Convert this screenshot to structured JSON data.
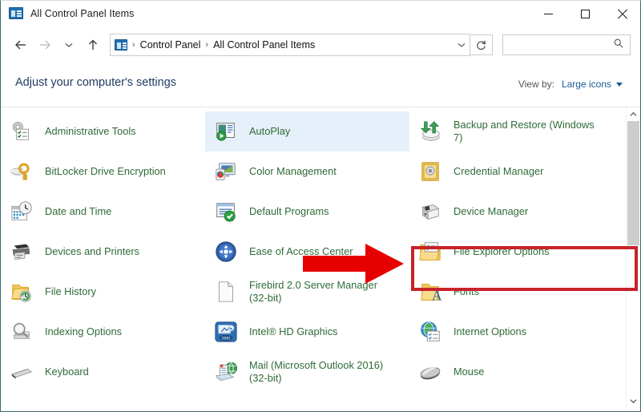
{
  "window": {
    "title": "All Control Panel Items",
    "title_icon": "control-panel-icon",
    "minimize_label": "Minimize",
    "maximize_label": "Maximize",
    "close_label": "Close"
  },
  "nav": {
    "back_icon": "back-arrow-icon",
    "forward_icon": "forward-arrow-icon",
    "recent_icon": "chevron-down-icon",
    "up_icon": "up-arrow-icon",
    "refresh_icon": "refresh-icon",
    "address_icon": "control-panel-icon",
    "breadcrumbs": [
      "Control Panel",
      "All Control Panel Items"
    ],
    "separator": "›",
    "dropdown_icon": "chevron-down-icon"
  },
  "search": {
    "value": "",
    "placeholder": "",
    "icon": "search-icon"
  },
  "header": {
    "page_title": "Adjust your computer's settings",
    "view_by_label": "View by:",
    "view_by_value": "Large icons",
    "view_by_caret": "caret-down-icon"
  },
  "colors": {
    "item_label": "#2e6b37",
    "page_title": "#1f3a5f",
    "link": "#1a5a96",
    "hover_row": "#e6f0fa",
    "annotation_red": "#c8222a",
    "window_border": "#3c6e71"
  },
  "items": {
    "column1": [
      {
        "label": "Administrative Tools",
        "icon": "administrative-tools-icon",
        "hover": false
      },
      {
        "label": "BitLocker Drive Encryption",
        "icon": "bitlocker-icon",
        "hover": false
      },
      {
        "label": "Date and Time",
        "icon": "date-and-time-icon",
        "hover": false
      },
      {
        "label": "Devices and Printers",
        "icon": "devices-and-printers-icon",
        "hover": false
      },
      {
        "label": "File History",
        "icon": "file-history-icon",
        "hover": false
      },
      {
        "label": "Indexing Options",
        "icon": "indexing-options-icon",
        "hover": false
      },
      {
        "label": "Keyboard",
        "icon": "keyboard-icon",
        "hover": false
      }
    ],
    "column2": [
      {
        "label": "AutoPlay",
        "icon": "autoplay-icon",
        "hover": true
      },
      {
        "label": "Color Management",
        "icon": "color-management-icon",
        "hover": false
      },
      {
        "label": "Default Programs",
        "icon": "default-programs-icon",
        "hover": false
      },
      {
        "label": "Ease of Access Center",
        "icon": "ease-of-access-icon",
        "hover": false
      },
      {
        "label": "Firebird 2.0 Server Manager (32-bit)",
        "icon": "firebird-server-manager-icon",
        "hover": false
      },
      {
        "label": "Intel® HD Graphics",
        "icon": "intel-hd-graphics-icon",
        "hover": false
      },
      {
        "label": "Mail (Microsoft Outlook 2016) (32-bit)",
        "icon": "mail-icon",
        "hover": false
      }
    ],
    "column3": [
      {
        "label": "Backup and Restore (Windows 7)",
        "icon": "backup-and-restore-icon",
        "hover": false
      },
      {
        "label": "Credential Manager",
        "icon": "credential-manager-icon",
        "hover": false
      },
      {
        "label": "Device Manager",
        "icon": "device-manager-icon",
        "hover": false
      },
      {
        "label": "File Explorer Options",
        "icon": "file-explorer-options-icon",
        "hover": false
      },
      {
        "label": "Fonts",
        "icon": "fonts-icon",
        "hover": false
      },
      {
        "label": "Internet Options",
        "icon": "internet-options-icon",
        "hover": false
      },
      {
        "label": "Mouse",
        "icon": "mouse-icon",
        "hover": false
      }
    ]
  },
  "scrollbar": {
    "up_icon": "scroll-up-icon",
    "down_icon": "scroll-down-icon",
    "thumb": "scrollbar-thumb"
  },
  "annotations": {
    "highlight_target": "File Explorer Options",
    "arrow": "red-pointer-arrow",
    "box": "red-highlight-box"
  }
}
